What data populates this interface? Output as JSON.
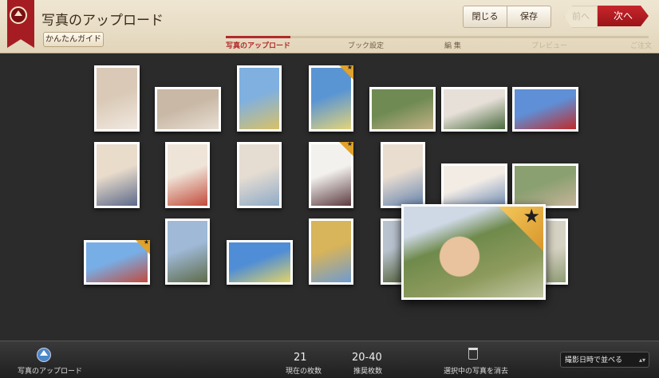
{
  "header": {
    "title": "写真のアップロード",
    "guide_label": "かんたんガイド",
    "close_label": "閉じる",
    "save_label": "保存",
    "prev_label": "前へ",
    "next_label": "次へ",
    "steps": [
      "写真のアップロード",
      "ブック設定",
      "編 集",
      "プレビュー",
      "ご注文"
    ],
    "active_step": 0
  },
  "photos": [
    {
      "favorite": false,
      "colors": [
        "#d9c9b6",
        "#f1e8df"
      ]
    },
    {
      "favorite": false,
      "colors": [
        "#c9b8a6",
        "#e8dfd3"
      ]
    },
    {
      "favorite": false,
      "colors": [
        "#7fb0e0",
        "#d9c168"
      ]
    },
    {
      "favorite": true,
      "colors": [
        "#5a95d3",
        "#e3d37a"
      ]
    },
    {
      "favorite": false,
      "colors": [
        "#6f8a52",
        "#c3b188"
      ]
    },
    {
      "favorite": false,
      "colors": [
        "#e6e0d8",
        "#4a6b3e"
      ]
    },
    {
      "favorite": false,
      "colors": [
        "#5f8fd6",
        "#c02a2a"
      ]
    },
    {
      "favorite": false,
      "colors": [
        "#e9dccb",
        "#5c6a8a"
      ]
    },
    {
      "favorite": false,
      "colors": [
        "#efe4d8",
        "#c24b3b"
      ]
    },
    {
      "favorite": false,
      "colors": [
        "#e6ddd2",
        "#8faac7"
      ]
    },
    {
      "favorite": true,
      "colors": [
        "#f3f1ee",
        "#5b3b40"
      ]
    },
    {
      "favorite": false,
      "colors": [
        "#e9ddd0",
        "#6a87b0"
      ]
    },
    {
      "favorite": false,
      "colors": [
        "#f2ece5",
        "#7792b8"
      ]
    },
    {
      "favorite": false,
      "colors": [
        "#8aa070",
        "#c6b49a"
      ]
    },
    {
      "favorite": true,
      "colors": [
        "#78aee6",
        "#c14b3e"
      ]
    },
    {
      "favorite": false,
      "colors": [
        "#9fb9d6",
        "#5e6b4a"
      ]
    },
    {
      "favorite": false,
      "colors": [
        "#4f8dd6",
        "#e1d467"
      ]
    },
    {
      "favorite": false,
      "colors": [
        "#d8b45a",
        "#6f9bd0"
      ]
    },
    {
      "favorite": false,
      "colors": [
        "#b9c3cf",
        "#5e6b4a"
      ]
    },
    {
      "favorite": false,
      "colors": [
        "#d7d3c4",
        "#8f9c74"
      ]
    }
  ],
  "featured_photo": {
    "favorite": true
  },
  "footer": {
    "upload_label": "写真のアップロード",
    "current_count": "21",
    "current_label": "現在の枚数",
    "recommended_count": "20-40",
    "recommended_label": "推奨枚数",
    "delete_label": "選択中の写真を消去",
    "sort_label": "撮影日時で並べる"
  },
  "colors": {
    "accent": "#a51d22",
    "header_bg": "#e9dfc8",
    "canvas_bg": "#2b2b2b",
    "star": "#e0a22a"
  }
}
